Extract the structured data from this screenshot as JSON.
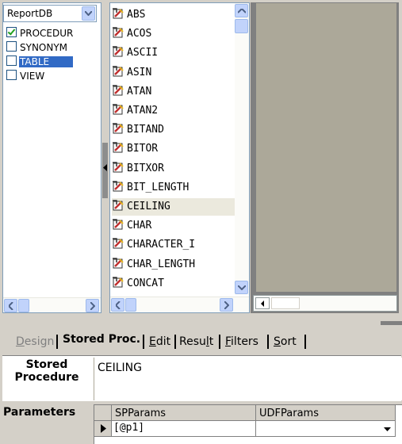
{
  "left_panel": {
    "database": "ReportDB",
    "object_types": [
      {
        "label": "PROCEDUR",
        "checked": true,
        "selected": false
      },
      {
        "label": "SYNONYM",
        "checked": false,
        "selected": false
      },
      {
        "label": "TABLE",
        "checked": false,
        "selected": true
      },
      {
        "label": "VIEW",
        "checked": false,
        "selected": false
      }
    ]
  },
  "function_list": {
    "items": [
      "ABS",
      "ACOS",
      "ASCII",
      "ASIN",
      "ATAN",
      "ATAN2",
      "BITAND",
      "BITOR",
      "BITXOR",
      "BIT_LENGTH",
      "CEILING",
      "CHAR",
      "CHARACTER_I",
      "CHAR_LENGTH",
      "CONCAT"
    ],
    "selected": "CEILING"
  },
  "tabs": [
    {
      "label": "Design",
      "state": "disabled"
    },
    {
      "label": "Stored Proc.",
      "state": "active"
    },
    {
      "label": "Edit",
      "state": "normal"
    },
    {
      "label": "Result",
      "state": "normal"
    },
    {
      "label": "Filters",
      "state": "normal"
    },
    {
      "label": "Sort",
      "state": "normal"
    }
  ],
  "stored_procedure": {
    "label_line1": "Stored",
    "label_line2": "Procedure",
    "value": "CEILING"
  },
  "parameters": {
    "label": "Parameters",
    "columns": [
      "SPParams",
      "UDFParams"
    ],
    "rows": [
      [
        "[@p1]",
        ""
      ]
    ]
  },
  "colors": {
    "selection": "#316ac5",
    "highlight_row": "#ebe9dd",
    "scroll_button": "#c1d3fb"
  }
}
